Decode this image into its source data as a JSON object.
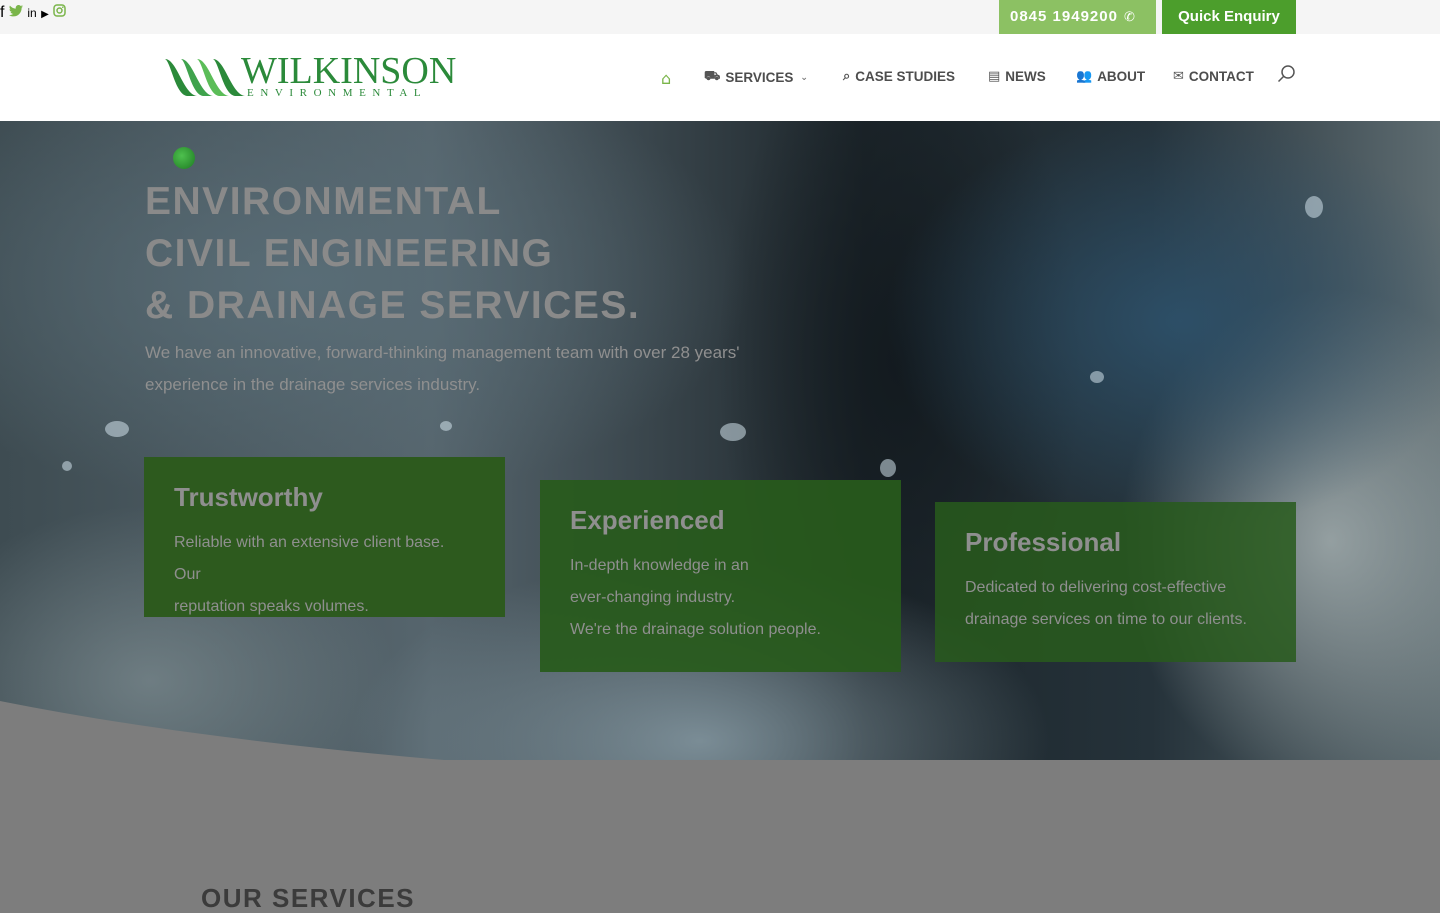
{
  "topbar": {
    "social": [
      {
        "name": "facebook",
        "glyph": "f"
      },
      {
        "name": "twitter",
        "glyph": "🐦"
      },
      {
        "name": "linkedin",
        "glyph": "in"
      },
      {
        "name": "youtube",
        "glyph": "▶"
      },
      {
        "name": "instagram",
        "glyph": "◎"
      }
    ],
    "phone": "0845 1949200",
    "phone_icon": "✆",
    "enquiry": "Quick Enquiry"
  },
  "header": {
    "logo_name": "WILKINSON",
    "logo_sub": "ENVIRONMENTAL",
    "nav": {
      "home_icon": "⌂",
      "services": "SERVICES",
      "services_icon": "⛟",
      "case_studies": "CASE STUDIES",
      "case_icon": "⌕",
      "news": "NEWS",
      "news_icon": "▤",
      "about": "ABOUT",
      "about_icon": "👥",
      "contact": "CONTACT",
      "contact_icon": "✉",
      "caret": "⌄"
    }
  },
  "hero": {
    "title_lines": [
      "ENVIRONMENTAL",
      "CIVIL ENGINEERING",
      "& DRAINAGE SERVICES."
    ],
    "subtitle": "We have an innovative, forward-thinking management team with over 28 years' experience in the drainage services industry."
  },
  "cards": [
    {
      "title": "Trustworthy",
      "lines": [
        "Reliable with an extensive client base. Our",
        "reputation speaks volumes."
      ]
    },
    {
      "title": "Experienced",
      "lines": [
        "In-depth knowledge in an",
        "ever-changing industry.",
        "We're the drainage solution people."
      ]
    },
    {
      "title": "Professional",
      "lines": [
        "Dedicated to delivering cost-effective",
        "drainage services on time to our clients."
      ]
    }
  ],
  "section": {
    "heading": "OUR SERVICES"
  },
  "colors": {
    "brand_green": "#4c9e2c",
    "light_green": "#8cc163",
    "card_green": "#2d5a1e"
  }
}
